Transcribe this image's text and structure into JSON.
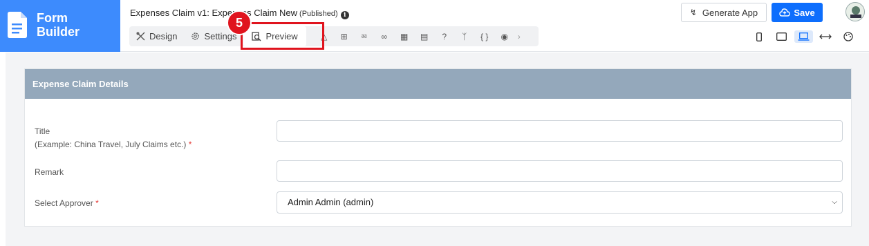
{
  "brand": {
    "line1": "Form",
    "line2": "Builder"
  },
  "form": {
    "title": "Expenses Claim v1: Expenses Claim New",
    "status": "(Published)"
  },
  "toolbar": {
    "design_label": "Design",
    "settings_label": "Settings",
    "preview_label": "Preview",
    "icons": [
      "hierarchy-icon",
      "import-icon",
      "lock-icon",
      "glasses-icon",
      "table-icon",
      "translate-icon",
      "help-icon",
      "branch-icon",
      "code-braces-icon",
      "camera-icon"
    ]
  },
  "annotation": {
    "step": "5"
  },
  "actions": {
    "generate_label": "Generate App",
    "save_label": "Save"
  },
  "devices": [
    "phone-icon",
    "tablet-icon",
    "laptop-icon",
    "expand-width-icon",
    "palette-icon"
  ],
  "section": {
    "title": "Expense Claim Details",
    "fields": [
      {
        "label": "Title",
        "hint": "(Example: China Travel, July Claims etc.)",
        "required": "*",
        "value": ""
      },
      {
        "label": "Remark",
        "value": ""
      },
      {
        "label": "Select Approver",
        "required": "*",
        "value": "Admin Admin (admin)"
      }
    ]
  },
  "colors": {
    "brand": "#3d8bfd",
    "save": "#0d6efd",
    "section_header": "#94a8bb",
    "highlight": "#e0141e"
  }
}
